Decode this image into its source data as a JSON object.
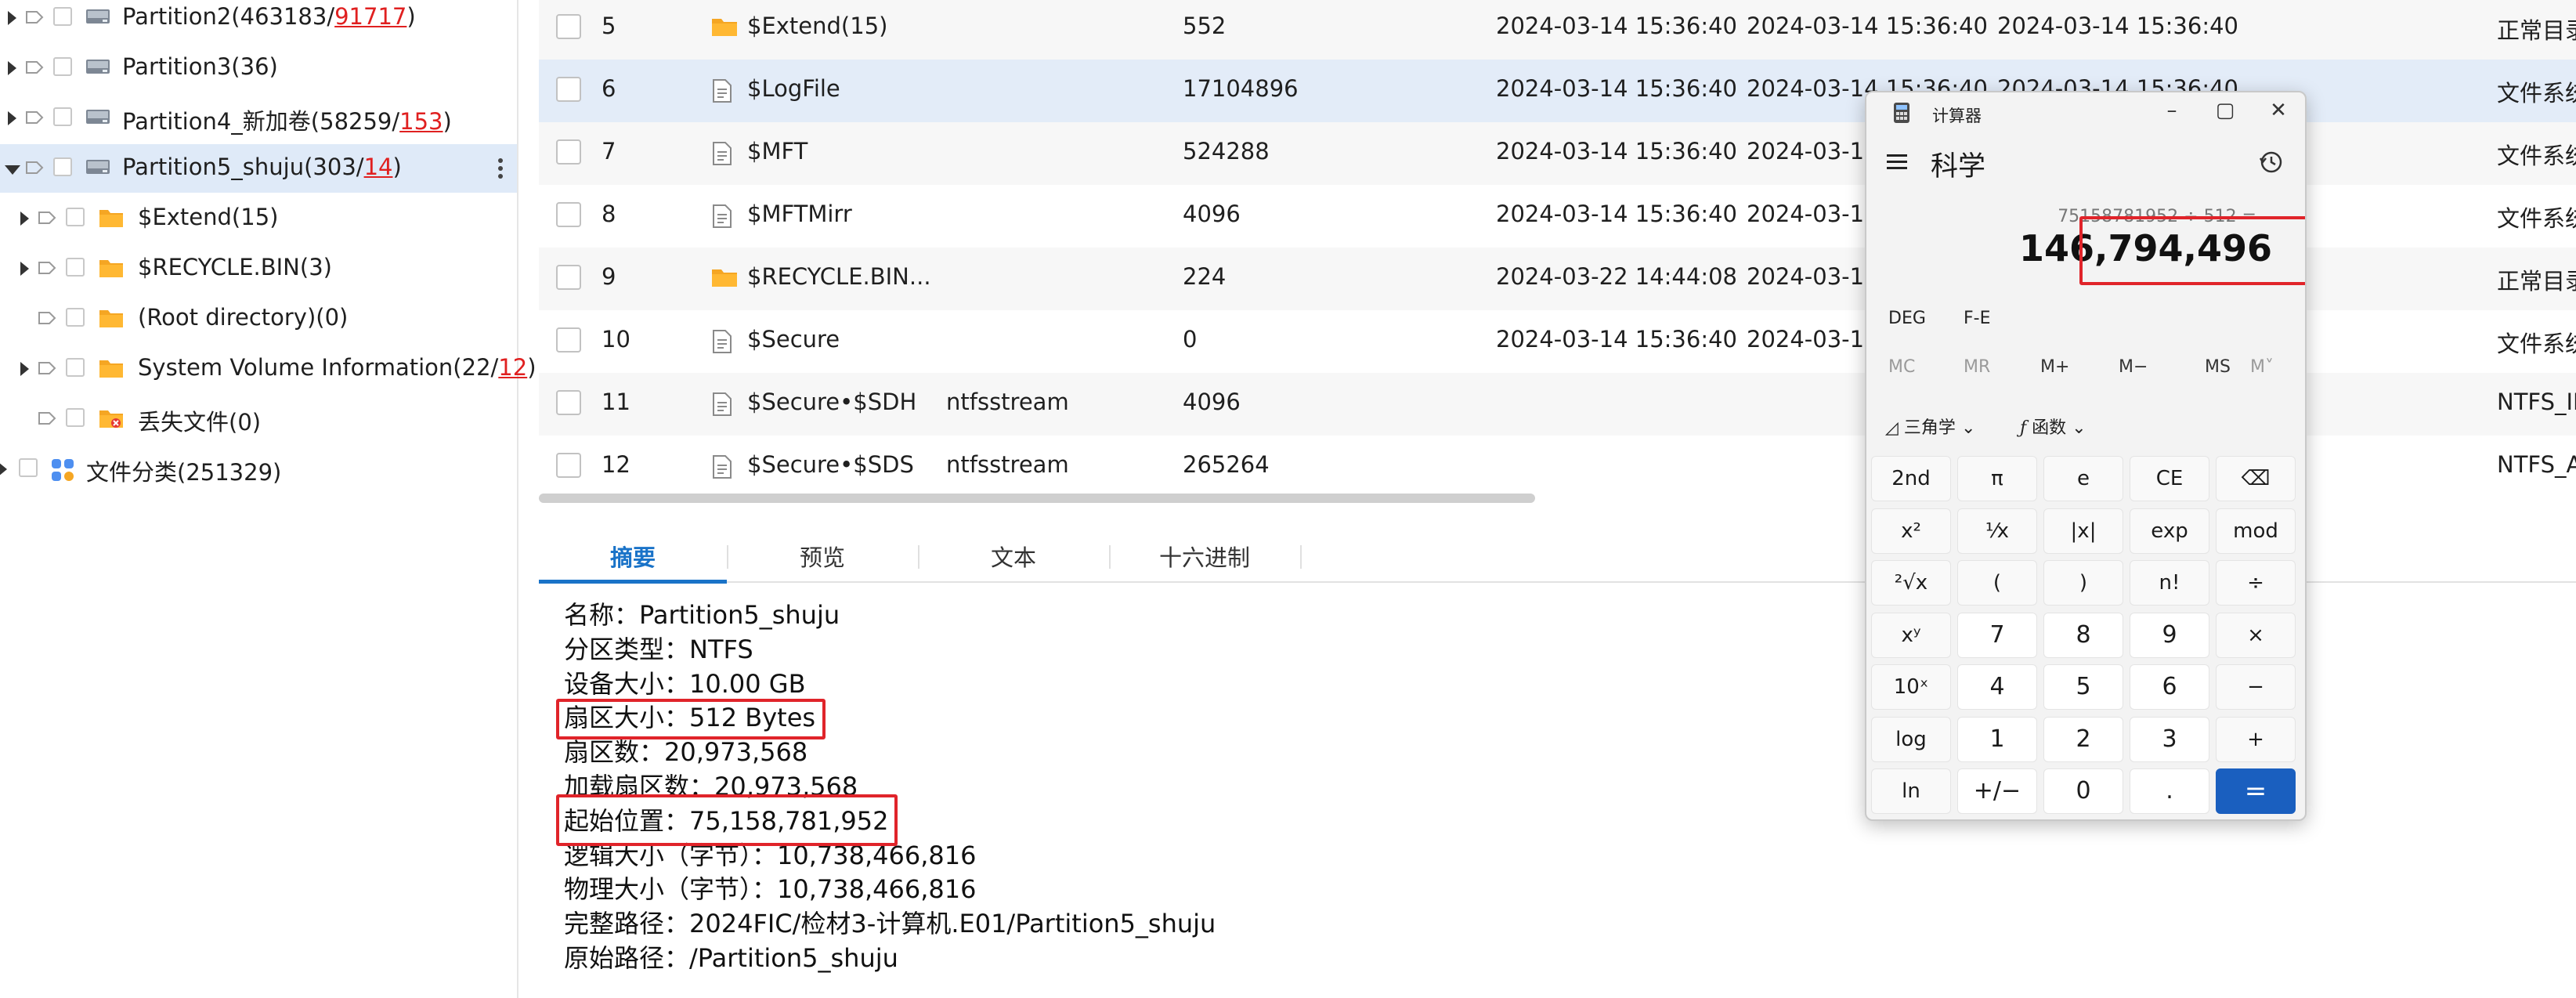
{
  "tree": {
    "items": [
      {
        "pre": "Partition2(463183/",
        "red": "91717",
        "post": ")"
      },
      {
        "pre": "Partition3(36)",
        "red": "",
        "post": ""
      },
      {
        "pre": "Partition4_新加卷(58259/",
        "red": "153",
        "post": ")"
      },
      {
        "pre": "Partition5_shuju(303/",
        "red": "14",
        "post": ")"
      },
      {
        "pre": "$Extend(15)",
        "red": "",
        "post": ""
      },
      {
        "pre": "$RECYCLE.BIN(3)",
        "red": "",
        "post": ""
      },
      {
        "pre": "(Root directory)(0)",
        "red": "",
        "post": ""
      },
      {
        "pre": "System Volume Information(22/",
        "red": "12",
        "post": ")"
      },
      {
        "pre": "丢失文件(0)",
        "red": "",
        "post": ""
      },
      {
        "pre": "文件分类(251329)",
        "red": "",
        "post": ""
      }
    ]
  },
  "files": {
    "rows": [
      {
        "no": "5",
        "name": "$Extend(15)",
        "type": "",
        "size": "552",
        "t1": "2024-03-14 15:36:40",
        "t2": "2024-03-14 15:36:40",
        "t3": "2024-03-14 15:36:40",
        "attr": "正常目录"
      },
      {
        "no": "6",
        "name": "$LogFile",
        "type": "",
        "size": "17104896",
        "t1": "2024-03-14 15:36:40",
        "t2": "2024-03-14 15:36:40",
        "t3": "2024-03-14 15:36:40",
        "attr": "文件系统"
      },
      {
        "no": "7",
        "name": "$MFT",
        "type": "",
        "size": "524288",
        "t1": "2024-03-14 15:36:40",
        "t2": "2024-03-14",
        "t3": "",
        "attr": "文件系统"
      },
      {
        "no": "8",
        "name": "$MFTMirr",
        "type": "",
        "size": "4096",
        "t1": "2024-03-14 15:36:40",
        "t2": "2024-03-14",
        "t3": "",
        "attr": "文件系统"
      },
      {
        "no": "9",
        "name": "$RECYCLE.BIN...",
        "type": "",
        "size": "224",
        "t1": "2024-03-22 14:44:08",
        "t2": "2024-03-14",
        "t3": "",
        "attr": "正常目录"
      },
      {
        "no": "10",
        "name": "$Secure",
        "type": "",
        "size": "0",
        "t1": "2024-03-14 15:36:40",
        "t2": "2024-03-14",
        "t3": "",
        "attr": "文件系统"
      },
      {
        "no": "11",
        "name": "$Secure•$SDH",
        "type": "ntfsstream",
        "size": "4096",
        "t1": "",
        "t2": "",
        "t3": "",
        "attr": "NTFS_IN"
      },
      {
        "no": "12",
        "name": "$Secure•$SDS",
        "type": "ntfsstream",
        "size": "265264",
        "t1": "",
        "t2": "",
        "t3": "",
        "attr": "NTFS_A"
      }
    ]
  },
  "detail": {
    "tabs": [
      "摘要",
      "预览",
      "文本",
      "十六进制"
    ],
    "lines": [
      "名称：Partition5_shuju",
      "分区类型：NTFS",
      "设备大小：10.00 GB",
      "扇区大小：512 Bytes",
      "扇区数：20,973,568",
      "加载扇区数：20,973,568",
      "起始位置：75,158,781,952",
      "逻辑大小（字节）：10,738,466,816",
      "物理大小（字节）：10,738,466,816",
      "完整路径：2024FIC/检材3-计算机.E01/Partition5_shuju",
      "原始路径：/Partition5_shuju"
    ]
  },
  "calculator": {
    "title": "计算器",
    "mode": "科学",
    "expression": "75158781952 ÷ 512 =",
    "result": "146,794,496",
    "deg": "DEG",
    "fe": "F-E",
    "memory": [
      "MC",
      "MR",
      "M+",
      "M−",
      "MS",
      "M˅"
    ],
    "trig": "三角学",
    "func": "函数",
    "keys": [
      [
        "2nd",
        "π",
        "e",
        "CE",
        "⌫"
      ],
      [
        "x²",
        "¹⁄x",
        "|x|",
        "exp",
        "mod"
      ],
      [
        "²√x",
        "(",
        ")",
        "n!",
        "÷"
      ],
      [
        "xʸ",
        "7",
        "8",
        "9",
        "×"
      ],
      [
        "10ˣ",
        "4",
        "5",
        "6",
        "−"
      ],
      [
        "log",
        "1",
        "2",
        "3",
        "+"
      ],
      [
        "ln",
        "+/−",
        "0",
        ".",
        "="
      ]
    ]
  },
  "colors": {
    "accent": "#1a73c8",
    "highlight": "#e0242a",
    "folder": "#f5a623",
    "equals": "#1a5fbf"
  }
}
